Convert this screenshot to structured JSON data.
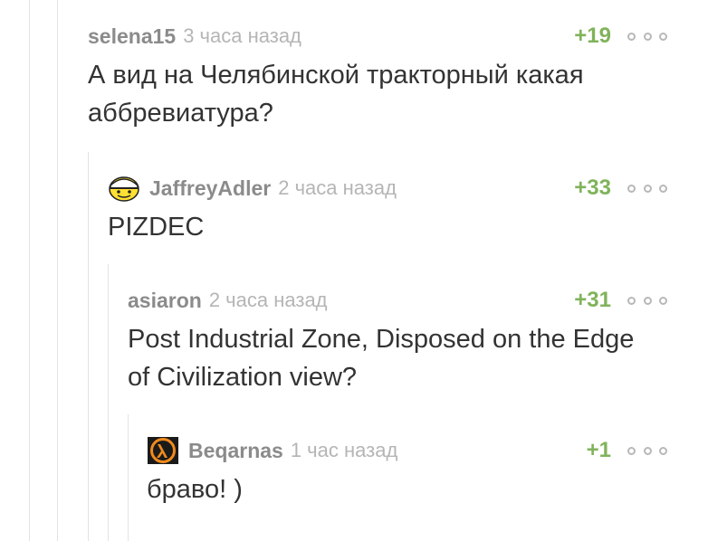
{
  "comments": [
    {
      "username": "selena15",
      "timestamp": "3 часа назад",
      "rating": "+19",
      "text_lines": [
        "А вид на Челябинской тракторный какая",
        "аббревиатура?"
      ],
      "avatar": null
    },
    {
      "username": "JaffreyAdler",
      "timestamp": "2 часа назад",
      "rating": "+33",
      "text_lines": [
        "PIZDEC"
      ],
      "avatar": "smiley-face-icon"
    },
    {
      "username": "asiaron",
      "timestamp": "2 часа назад",
      "rating": "+31",
      "text_lines": [
        "Post Industrial Zone, Disposed on the Edge",
        "of Civilization view?"
      ],
      "avatar": null
    },
    {
      "username": "Beqarnas",
      "timestamp": "1 час назад",
      "rating": "+1",
      "text_lines": [
        "браво! )"
      ],
      "avatar": "half-life-lambda-icon"
    }
  ],
  "colors": {
    "username": "#8b8b8b",
    "timestamp": "#b5b5b5",
    "rating_positive": "#80b35b",
    "text": "#333333",
    "thread_line": "#e3e3e3",
    "more_icon": "#b8b8b8"
  }
}
